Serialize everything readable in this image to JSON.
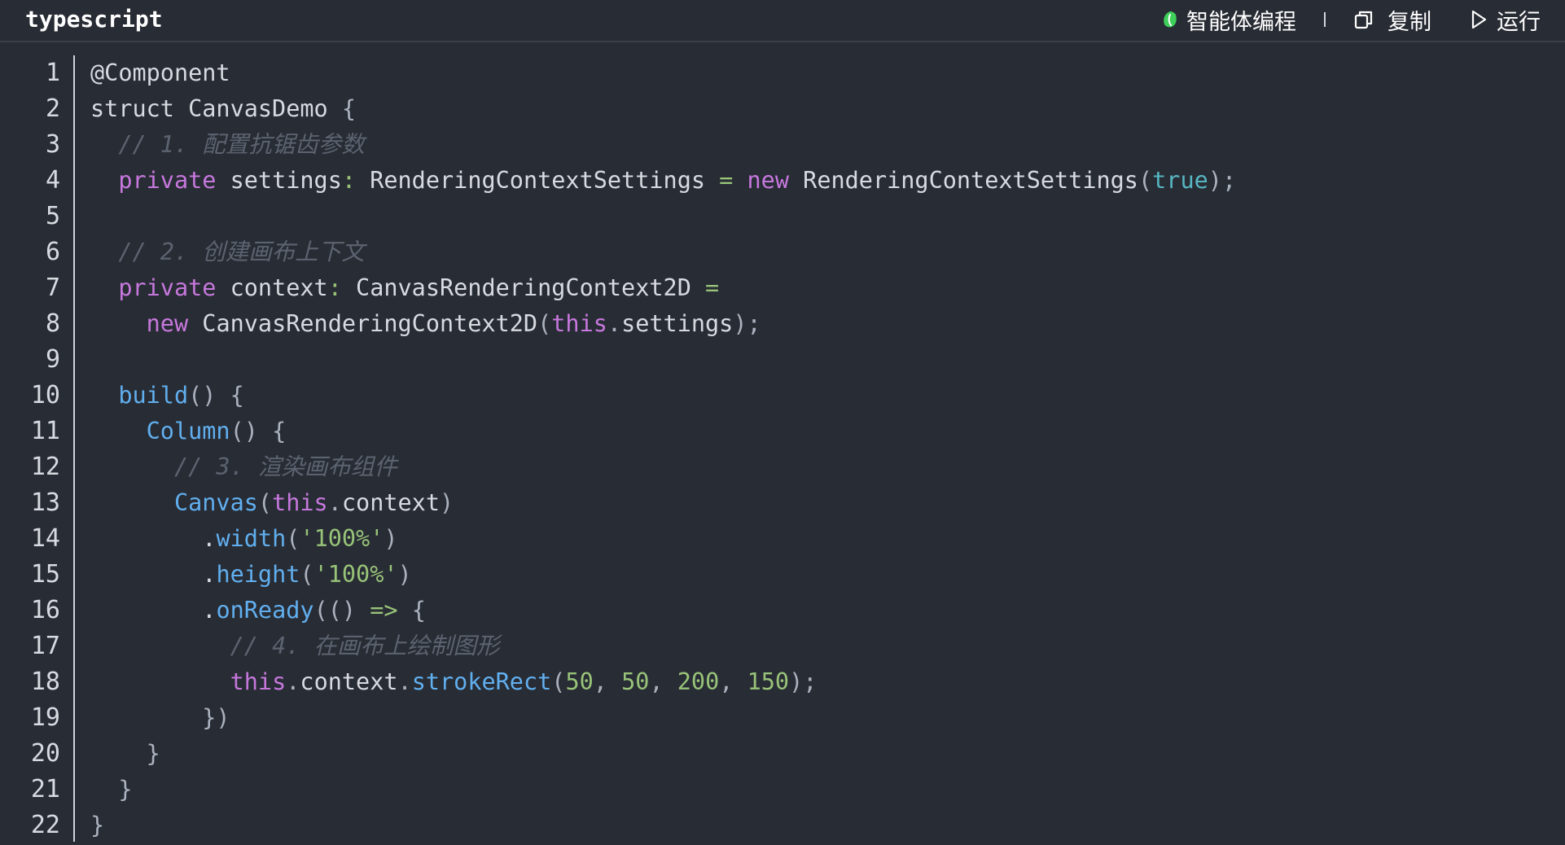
{
  "header": {
    "language": "typescript",
    "ai_label": "智能体编程",
    "copy_label": "复制",
    "run_label": "运行",
    "ai_icon": "leaf-logo-icon",
    "copy_icon": "copy-icon",
    "run_icon": "play-icon"
  },
  "colors": {
    "background": "#282c34",
    "keyword": "#c678dd",
    "function": "#61afef",
    "string": "#98c379",
    "boolean": "#56b6c2",
    "comment": "#5c6370",
    "ai_icon": "#3ecf5a"
  },
  "code": {
    "line_numbers": [
      "1",
      "2",
      "3",
      "4",
      "5",
      "6",
      "7",
      "8",
      "9",
      "10",
      "11",
      "12",
      "13",
      "14",
      "15",
      "16",
      "17",
      "18",
      "19",
      "20",
      "21",
      "22"
    ],
    "lines": [
      [
        {
          "t": "decorator",
          "v": "@Component"
        }
      ],
      [
        {
          "t": "text",
          "v": "struct CanvasDemo "
        },
        {
          "t": "plain",
          "v": "{"
        }
      ],
      [
        {
          "t": "plain",
          "v": "  "
        },
        {
          "t": "comment",
          "v": "// 1. 配置抗锯齿参数"
        }
      ],
      [
        {
          "t": "plain",
          "v": "  "
        },
        {
          "t": "keyword",
          "v": "private"
        },
        {
          "t": "text",
          "v": " settings"
        },
        {
          "t": "op",
          "v": ":"
        },
        {
          "t": "text",
          "v": " RenderingContextSettings "
        },
        {
          "t": "op",
          "v": "="
        },
        {
          "t": "plain",
          "v": " "
        },
        {
          "t": "keyword",
          "v": "new"
        },
        {
          "t": "text",
          "v": " RenderingContextSettings"
        },
        {
          "t": "plain",
          "v": "("
        },
        {
          "t": "bool",
          "v": "true"
        },
        {
          "t": "plain",
          "v": ");"
        }
      ],
      [],
      [
        {
          "t": "plain",
          "v": "  "
        },
        {
          "t": "comment",
          "v": "// 2. 创建画布上下文"
        }
      ],
      [
        {
          "t": "plain",
          "v": "  "
        },
        {
          "t": "keyword",
          "v": "private"
        },
        {
          "t": "text",
          "v": " context"
        },
        {
          "t": "op",
          "v": ":"
        },
        {
          "t": "text",
          "v": " CanvasRenderingContext2D "
        },
        {
          "t": "op",
          "v": "="
        }
      ],
      [
        {
          "t": "plain",
          "v": "    "
        },
        {
          "t": "keyword",
          "v": "new"
        },
        {
          "t": "text",
          "v": " CanvasRenderingContext2D"
        },
        {
          "t": "plain",
          "v": "("
        },
        {
          "t": "keyword",
          "v": "this"
        },
        {
          "t": "plain",
          "v": "."
        },
        {
          "t": "text",
          "v": "settings"
        },
        {
          "t": "plain",
          "v": ");"
        }
      ],
      [],
      [
        {
          "t": "plain",
          "v": "  "
        },
        {
          "t": "func",
          "v": "build"
        },
        {
          "t": "plain",
          "v": "() {"
        }
      ],
      [
        {
          "t": "plain",
          "v": "    "
        },
        {
          "t": "func",
          "v": "Column"
        },
        {
          "t": "plain",
          "v": "() {"
        }
      ],
      [
        {
          "t": "plain",
          "v": "      "
        },
        {
          "t": "comment",
          "v": "// 3. 渲染画布组件"
        }
      ],
      [
        {
          "t": "plain",
          "v": "      "
        },
        {
          "t": "func",
          "v": "Canvas"
        },
        {
          "t": "plain",
          "v": "("
        },
        {
          "t": "keyword",
          "v": "this"
        },
        {
          "t": "plain",
          "v": "."
        },
        {
          "t": "text",
          "v": "context"
        },
        {
          "t": "plain",
          "v": ")"
        }
      ],
      [
        {
          "t": "plain",
          "v": "        "
        },
        {
          "t": "text",
          "v": "."
        },
        {
          "t": "func",
          "v": "width"
        },
        {
          "t": "plain",
          "v": "("
        },
        {
          "t": "string",
          "v": "'100%'"
        },
        {
          "t": "plain",
          "v": ")"
        }
      ],
      [
        {
          "t": "plain",
          "v": "        "
        },
        {
          "t": "text",
          "v": "."
        },
        {
          "t": "func",
          "v": "height"
        },
        {
          "t": "plain",
          "v": "("
        },
        {
          "t": "string",
          "v": "'100%'"
        },
        {
          "t": "plain",
          "v": ")"
        }
      ],
      [
        {
          "t": "plain",
          "v": "        "
        },
        {
          "t": "text",
          "v": "."
        },
        {
          "t": "func",
          "v": "onReady"
        },
        {
          "t": "plain",
          "v": "(() "
        },
        {
          "t": "op",
          "v": "=>"
        },
        {
          "t": "plain",
          "v": " {"
        }
      ],
      [
        {
          "t": "plain",
          "v": "          "
        },
        {
          "t": "comment",
          "v": "// 4. 在画布上绘制图形"
        }
      ],
      [
        {
          "t": "plain",
          "v": "          "
        },
        {
          "t": "keyword",
          "v": "this"
        },
        {
          "t": "plain",
          "v": "."
        },
        {
          "t": "text",
          "v": "context"
        },
        {
          "t": "plain",
          "v": "."
        },
        {
          "t": "func",
          "v": "strokeRect"
        },
        {
          "t": "plain",
          "v": "("
        },
        {
          "t": "number",
          "v": "50"
        },
        {
          "t": "plain",
          "v": ", "
        },
        {
          "t": "number",
          "v": "50"
        },
        {
          "t": "plain",
          "v": ", "
        },
        {
          "t": "number",
          "v": "200"
        },
        {
          "t": "plain",
          "v": ", "
        },
        {
          "t": "number",
          "v": "150"
        },
        {
          "t": "plain",
          "v": ");"
        }
      ],
      [
        {
          "t": "plain",
          "v": "        })"
        }
      ],
      [
        {
          "t": "plain",
          "v": "    }"
        }
      ],
      [
        {
          "t": "plain",
          "v": "  }"
        }
      ],
      [
        {
          "t": "plain",
          "v": "}"
        }
      ]
    ]
  }
}
